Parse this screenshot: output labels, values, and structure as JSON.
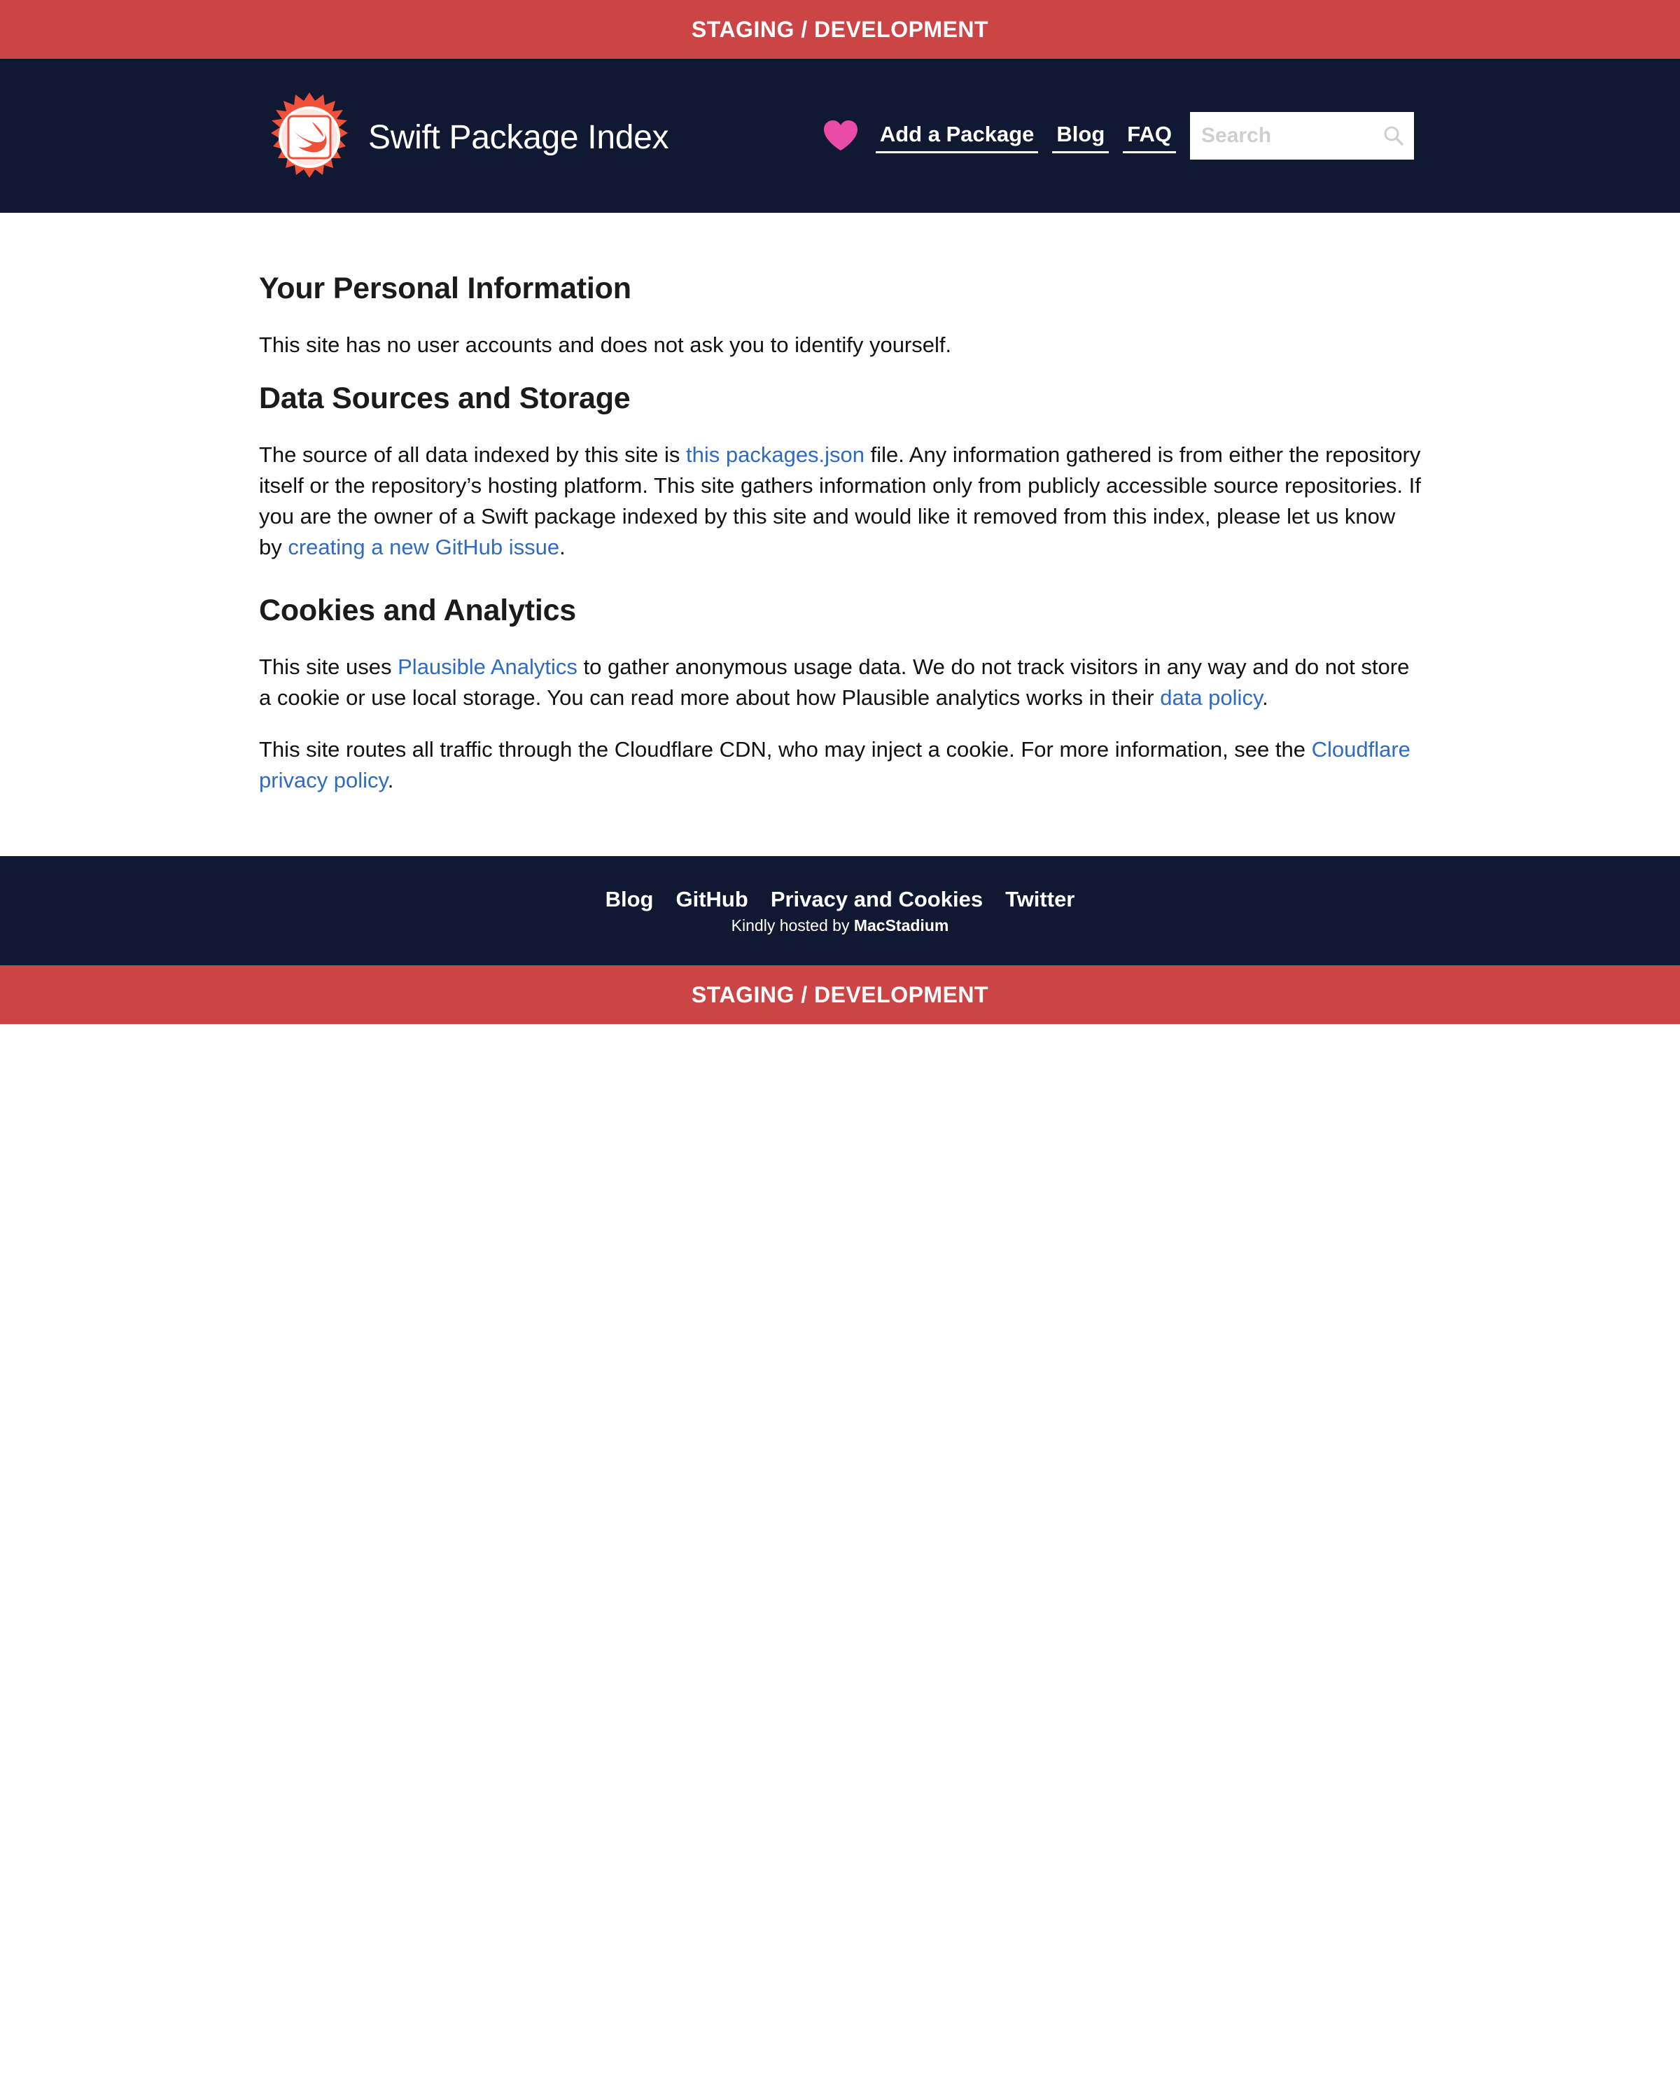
{
  "env_banner": {
    "label": "STAGING / DEVELOPMENT"
  },
  "header": {
    "title": "Swift Package Index",
    "nav": {
      "add_package": "Add a Package",
      "blog": "Blog",
      "faq": "FAQ"
    },
    "search": {
      "placeholder": "Search",
      "value": ""
    }
  },
  "sections": {
    "personal": {
      "heading": "Your Personal Information",
      "body": "This site has no user accounts and does not ask you to identify yourself."
    },
    "data": {
      "heading": "Data Sources and Storage",
      "p1_before": "The source of all data indexed by this site is ",
      "p1_link1": "this packages.json",
      "p1_middle": " file. Any information gathered is from either the repository itself or the repository’s hosting platform. This site gathers information only from publicly accessible source repositories. If you are the owner of a Swift package indexed by this site and would like it removed from this index, please let us know by ",
      "p1_link2": "creating a new GitHub issue",
      "p1_end": "."
    },
    "cookies": {
      "heading": "Cookies and Analytics",
      "p1_before": "This site uses ",
      "p1_link1": "Plausible Analytics",
      "p1_middle": " to gather anonymous usage data. We do not track visitors in any way and do not store a cookie or use local storage. You can read more about how Plausible analytics works in their ",
      "p1_link2": "data policy",
      "p1_end": ".",
      "p2_before": "This site routes all traffic through the Cloudflare CDN, who may inject a cookie. For more information, see the ",
      "p2_link": "Cloudflare privacy policy",
      "p2_end": "."
    }
  },
  "footer": {
    "links": {
      "blog": "Blog",
      "github": "GitHub",
      "privacy": "Privacy and Cookies",
      "twitter": "Twitter"
    },
    "hosted_prefix": "Kindly hosted by ",
    "hosted_brand": "MacStadium"
  },
  "colors": {
    "banner": "#cb4446",
    "header_bg": "#111832",
    "link": "#2f6bc3",
    "heart": "#e94ba8",
    "logo_orange": "#f05138"
  },
  "icons": {
    "logo": "swift-logo-badge",
    "heart": "heart-icon",
    "search": "search-icon"
  }
}
